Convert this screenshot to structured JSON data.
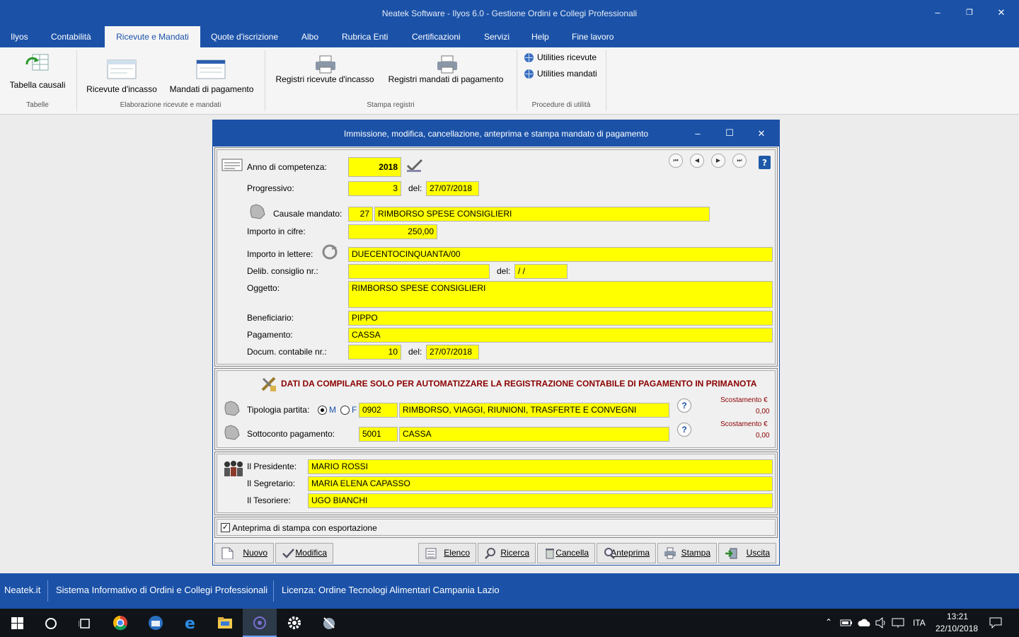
{
  "window": {
    "title": "Neatek Software - Ilyos 6.0 - Gestione Ordini e Collegi Professionali",
    "minimize": "–",
    "restore": "❐",
    "close": "✕"
  },
  "menu": [
    "Ilyos",
    "Contabilità",
    "Ricevute e Mandati",
    "Quote d'iscrizione",
    "Albo",
    "Rubrica Enti",
    "Certificazioni",
    "Servizi",
    "Help",
    "Fine lavoro"
  ],
  "ribbon": {
    "tabella_causali": "Tabella causali",
    "group_tabelle": "Tabelle",
    "ricevute_incasso": "Ricevute d'incasso",
    "mandati_pagamento": "Mandati di pagamento",
    "group_elaborazione": "Elaborazione ricevute e mandati",
    "registri_incasso": "Registri ricevute d'incasso",
    "registri_pagamento": "Registri mandati di pagamento",
    "group_stampa": "Stampa registri",
    "utilities_ricevute": "Utilities ricevute",
    "utilities_mandati": "Utilities mandati",
    "group_procedure": "Procedure di utilità"
  },
  "dialog": {
    "title": "Immissione, modifica, cancellazione, anteprima e stampa mandato di pagamento",
    "anno_label": "Anno di competenza:",
    "anno_value": "2018",
    "progressivo_label": "Progressivo:",
    "progressivo_value": "3",
    "del_label": "del:",
    "progressivo_date": "27/07/2018",
    "causale_label": "Causale mandato:",
    "causale_code": "27",
    "causale_desc": "RIMBORSO SPESE CONSIGLIERI",
    "importo_cifre_label": "Importo in cifre:",
    "importo_cifre_value": "250,00",
    "importo_lettere_label": "Importo in lettere:",
    "importo_lettere_value": "DUECENTOCINQUANTA/00",
    "delib_label": "Delib. consiglio nr.:",
    "delib_value": "",
    "delib_date": " / /",
    "oggetto_label": "Oggetto:",
    "oggetto_value": "RIMBORSO SPESE CONSIGLIERI",
    "beneficiario_label": "Beneficiario:",
    "beneficiario_value": "PIPPO",
    "pagamento_label": "Pagamento:",
    "pagamento_value": "CASSA",
    "docum_label": "Docum. contabile nr.:",
    "docum_value": "10",
    "docum_date": "27/07/2018",
    "primanota_title": "DATI DA  COMPILARE SOLO PER AUTOMATIZZARE LA REGISTRAZIONE CONTABILE DI PAGAMENTO IN PRIMANOTA",
    "tipologia_label": "Tipologia partita:",
    "radio_m": "M",
    "radio_f": "F",
    "tipologia_code": "0902",
    "tipologia_desc": "RIMBORSO, VIAGGI, RIUNIONI, TRASFERTE E CONVEGNI",
    "scostamento_label": "Scostamento €",
    "scostamento1": "0,00",
    "sottoconto_label": "Sottoconto pagamento:",
    "sottoconto_code": "5001",
    "sottoconto_desc": "CASSA",
    "scostamento2": "0,00",
    "presidente_label": "Il Presidente:",
    "presidente_value": "MARIO ROSSI",
    "segretario_label": "Il Segretario:",
    "segretario_value": "MARIA ELENA CAPASSO",
    "tesoriere_label": "Il Tesoriere:",
    "tesoriere_value": "UGO BIANCHI",
    "anteprima_check": "Anteprima di stampa con esportazione",
    "help_q": "?",
    "buttons": {
      "nuovo": "Nuovo",
      "modifica": "Modifica",
      "elenco": "Elenco",
      "ricerca": "Ricerca",
      "cancella": "Cancella",
      "anteprima": "Anteprima",
      "stampa": "Stampa",
      "uscita": "Uscita"
    }
  },
  "status": {
    "site": "Neatek.it",
    "system": "Sistema Informativo di Ordini e Collegi Professionali",
    "license": "Licenza: Ordine Tecnologi Alimentari Campania Lazio"
  },
  "taskbar": {
    "lang": "ITA",
    "time": "13:21",
    "date": "22/10/2018"
  },
  "colors": {
    "accent": "#1b52a8",
    "field": "#ffff00",
    "section_title": "#8b0000"
  }
}
